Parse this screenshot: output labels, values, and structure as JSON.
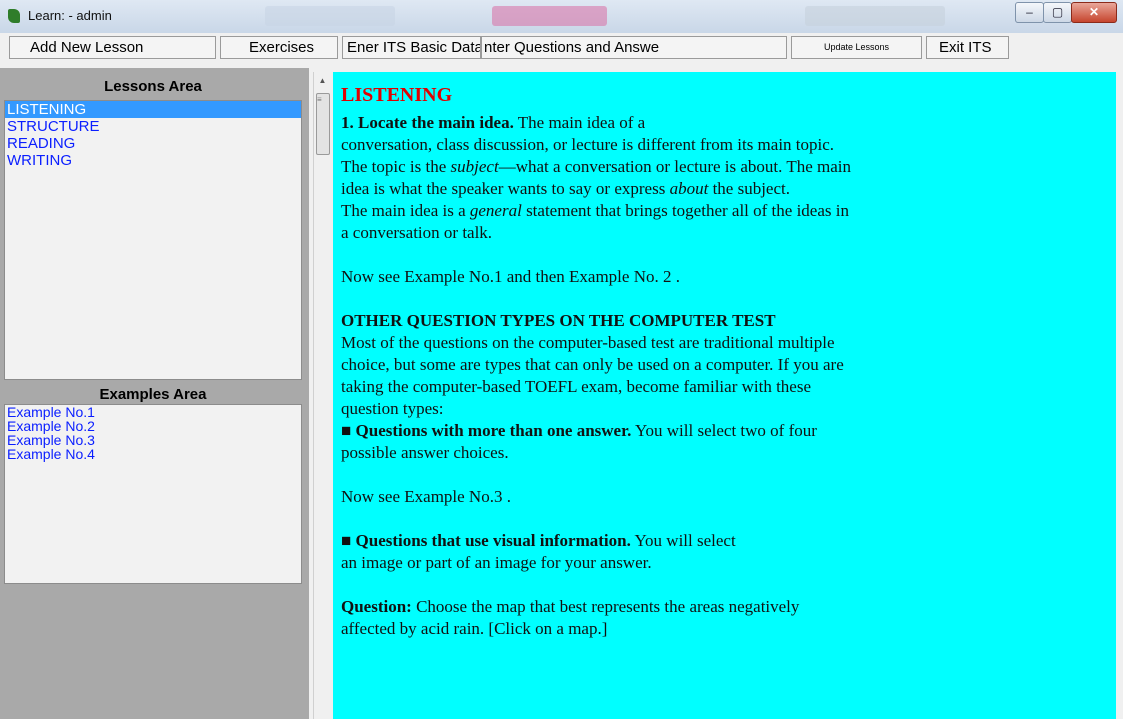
{
  "window": {
    "title": "Learn:  - admin"
  },
  "toolbar": {
    "add_new_lesson": "Add New Lesson",
    "exercises": "Exercises",
    "enter_basic_data": "Ener ITS Basic Data",
    "enter_qa": "nter Questions and Answe",
    "update_lessons": "Update Lessons",
    "exit": "Exit ITS"
  },
  "lessons": {
    "header": "Lessons Area",
    "items": [
      "LISTENING",
      "STRUCTURE",
      "READING",
      "WRITING"
    ]
  },
  "examples": {
    "header": "Examples Area",
    "items": [
      "Example  No.1",
      "Example  No.2",
      "Example  No.3",
      "Example  No.4"
    ]
  },
  "content": {
    "title": "LISTENING",
    "p1_bold": "1. Locate the main idea.",
    "p1_l1": " The main idea of a",
    "p1_l2": "conversation, class discussion, or lecture is different from its main topic.",
    "p1_l3a": "The topic is the ",
    "p1_l3_em": "subject",
    "p1_l3b": "—what a conversation or lecture is about. The main",
    "p1_l4a": "idea is what the speaker wants to say or express ",
    "p1_l4_em": "about",
    "p1_l4b": " the subject.",
    "p1_l5a": "The main idea is a ",
    "p1_l5_em": "general",
    "p1_l5b": " statement that brings together all of the ideas in",
    "p1_l6": "a conversation or talk.",
    "see1": "Now see  Example No.1 and then Example No. 2 .",
    "other_heading": "OTHER QUESTION TYPES ON THE COMPUTER TEST",
    "other_l1": "Most of the questions on the computer-based test are traditional multiple",
    "other_l2": "choice, but some are types that can only be used on a computer. If you are",
    "other_l3": "taking the computer-based TOEFL exam, become familiar with these",
    "other_l4": "question types:",
    "b1_bold": "■ Questions with more than one answer.",
    "b1_rest": " You will select two of four",
    "b1_l2": "possible answer choices.",
    "see3": "Now see Example No.3  .",
    "b2_bold": "■ Questions that use visual information.",
    "b2_rest": " You will select",
    "b2_l2": "an image or part of an image for your answer.",
    "q_bold": "Question:",
    "q_rest": " Choose the map that best represents the areas negatively",
    "q_l2": "affected by acid rain. [Click on a map.]"
  },
  "colors": {
    "content_bg": "#00ffff",
    "title_red": "#e00000",
    "link_blue": "#0a1eff",
    "selection": "#3399ff"
  },
  "icons": [
    "app-icon",
    "minimize-icon",
    "maximize-icon",
    "close-icon"
  ]
}
